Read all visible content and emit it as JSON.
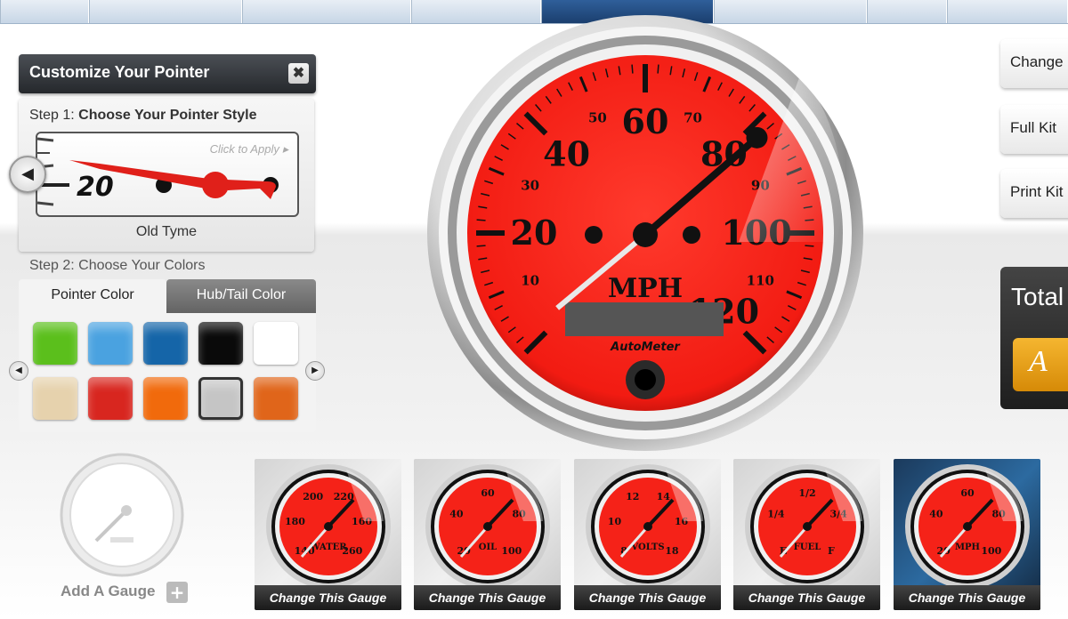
{
  "panel": {
    "title": "Customize Your Pointer",
    "close_glyph": "✖",
    "step1_prefix": "Step 1:",
    "step1_text": "Choose Your Pointer Style",
    "click_to_apply": "Click to Apply",
    "apply_arrow": "▸",
    "preview_number": "20",
    "prev_glyph": "◀",
    "style_name": "Old Tyme",
    "step2_prefix": "Step 2:",
    "step2_text": "Choose Your Colors",
    "tabs": [
      {
        "label": "Pointer Color",
        "active": true
      },
      {
        "label": "Hub/Tail Color",
        "active": false
      }
    ],
    "swatch_colors": [
      "#5bbf1c",
      "#4aa2e0",
      "#1565a8",
      "#0a0a0a",
      "#ffffff",
      "#e6d2ad",
      "#d8261f",
      "#f16a0c",
      "#c5c5c5",
      "#e0651a"
    ],
    "selected_swatch": 8,
    "left_arrow_glyph": "◀",
    "right_arrow_glyph": "▶"
  },
  "main_gauge": {
    "face_color": "#ff2a1f",
    "unit": "MPH",
    "brand": "AutoMeter",
    "major_labels": [
      "20",
      "40",
      "60",
      "80",
      "100",
      "120"
    ],
    "minor_labels": [
      "10",
      "30",
      "50",
      "70",
      "90",
      "110"
    ],
    "needle_value": 82
  },
  "right_panel": {
    "buttons": [
      "Change",
      "Full Kit",
      "Print Kit"
    ],
    "total_label": "Total",
    "add_label": "A"
  },
  "add_gauge": {
    "label": "Add A Gauge",
    "plus": "+"
  },
  "thumbnails": [
    {
      "name": "WATER",
      "labels": [
        "140",
        "180",
        "200",
        "220",
        "160",
        "260"
      ],
      "caption": "Change This Gauge",
      "dark": false
    },
    {
      "name": "OIL",
      "labels": [
        "20",
        "40",
        "60",
        "80",
        "100"
      ],
      "caption": "Change This Gauge",
      "dark": false
    },
    {
      "name": "VOLTS",
      "labels": [
        "8",
        "10",
        "12",
        "14",
        "16",
        "18"
      ],
      "caption": "Change This Gauge",
      "dark": false
    },
    {
      "name": "FUEL",
      "labels": [
        "E",
        "1/4",
        "1/2",
        "3/4",
        "F"
      ],
      "caption": "Change This Gauge",
      "dark": false
    },
    {
      "name": "MPH",
      "labels": [
        "20",
        "40",
        "60",
        "80",
        "100"
      ],
      "caption": "Change This Gauge",
      "dark": true
    }
  ]
}
